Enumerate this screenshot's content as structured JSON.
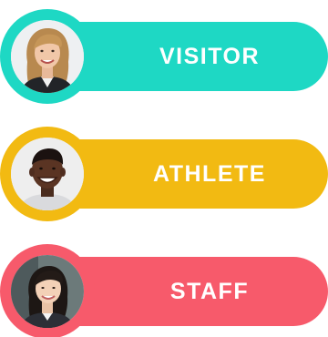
{
  "roles": [
    {
      "label": "VISITOR",
      "color": "#1ed8c4"
    },
    {
      "label": "ATHLETE",
      "color": "#f2ba12"
    },
    {
      "label": "STAFF",
      "color": "#f75a6b"
    }
  ]
}
